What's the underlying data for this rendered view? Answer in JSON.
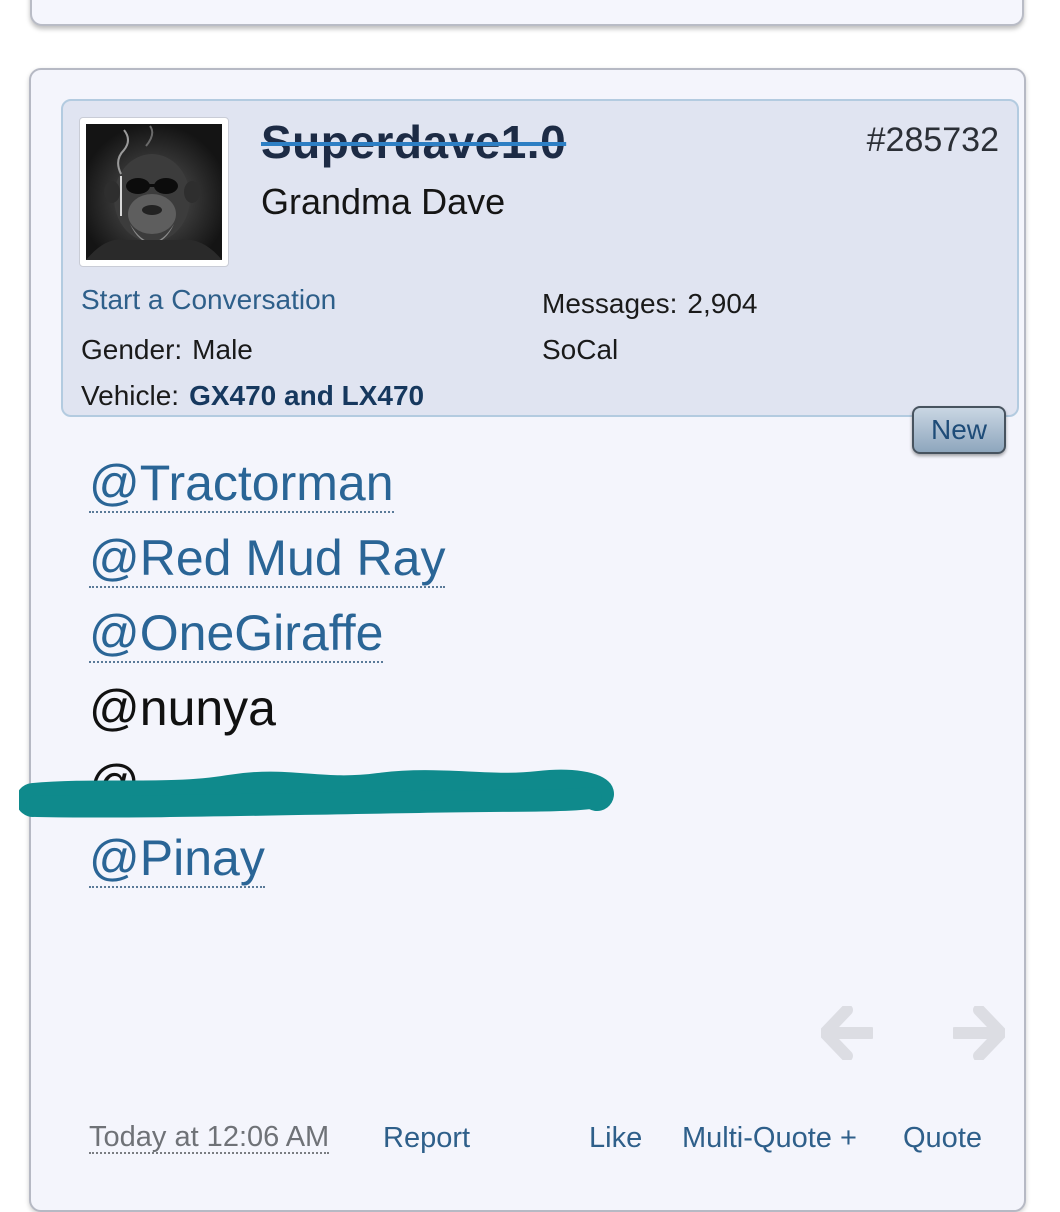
{
  "post": {
    "username": "Superdave1.0",
    "user_title": "Grandma Dave",
    "post_number": "#285732",
    "start_conversation": "Start a Conversation",
    "gender_label": "Gender:",
    "gender_value": "Male",
    "vehicle_label": "Vehicle:",
    "vehicle_value": "GX470 and LX470",
    "messages_label": "Messages:",
    "messages_value": "2,904",
    "location": "SoCal",
    "new_badge": "New"
  },
  "mentions": [
    {
      "text": "@Tractorman",
      "link": true
    },
    {
      "text": "@Red Mud Ray",
      "link": true
    },
    {
      "text": "@OneGiraffe",
      "link": true
    },
    {
      "text": "@nunya",
      "link": false
    },
    {
      "text": "@",
      "link": false
    },
    {
      "text": "@Pinay",
      "link": true
    }
  ],
  "footer": {
    "timestamp": "Today at 12:06 AM",
    "report": "Report",
    "like": "Like",
    "multi_quote": "Multi-Quote +",
    "quote": "Quote"
  },
  "icons": {
    "prev": "arrow-left-icon",
    "next": "arrow-right-icon"
  },
  "colors": {
    "link": "#2a6596",
    "scribble": "#0f8a8c",
    "panel_bg": "#e0e4f1"
  }
}
